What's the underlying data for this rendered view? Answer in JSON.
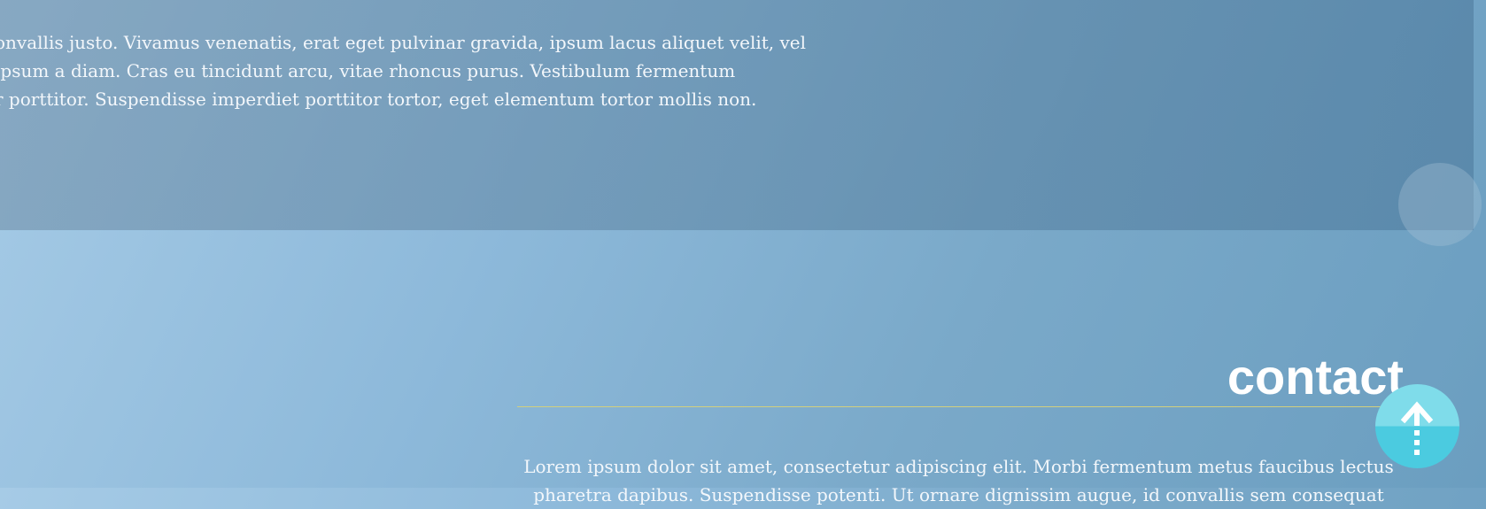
{
  "intro": {
    "lines": [
      "onvallis justo. Vivamus venenatis, erat eget pulvinar gravida, ipsum lacus aliquet velit, vel",
      " ipsum a diam. Cras eu tincidunt arcu, vitae rhoncus purus. Vestibulum fermentum",
      "r porttitor. Suspendisse imperdiet porttitor tortor, eget elementum tortor mollis non."
    ]
  },
  "contact": {
    "title": "contact",
    "lines": [
      "Lorem ipsum dolor sit amet, consectetur adipiscing elit. Morbi fermentum metus faucibus lectus",
      "pharetra dapibus. Suspendisse potenti. Ut ornare dignissim augue, id convallis sem consequat"
    ]
  },
  "scroll_top": {
    "icon": "arrow-up-icon"
  },
  "colors": {
    "accent_rule": "#d2cf7e",
    "button_light": "#7fdcea",
    "button_dark": "#4bcbe0"
  }
}
